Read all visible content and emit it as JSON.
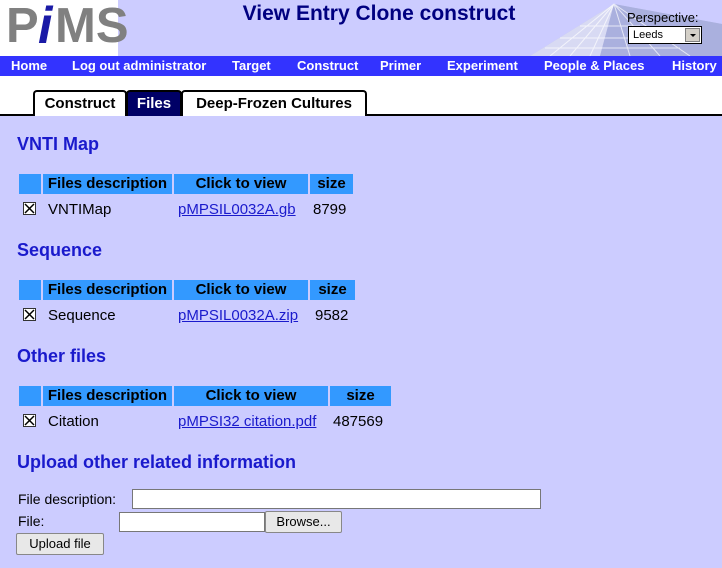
{
  "header": {
    "logo_letters": [
      "P",
      "i",
      "MS"
    ],
    "title": "View Entry Clone construct",
    "perspective_label": "Perspective:",
    "perspective_value": "Leeds"
  },
  "nav": [
    "Home",
    "Log out administrator",
    "Target",
    "Construct",
    "Primer",
    "Experiment",
    "People & Places",
    "History"
  ],
  "tabs": [
    {
      "label": "Construct",
      "active": false
    },
    {
      "label": "Files",
      "active": true
    },
    {
      "label": "Deep-Frozen Cultures",
      "active": false
    }
  ],
  "sections": [
    {
      "title": "VNTI Map",
      "headers": [
        "Files description",
        "Click to view",
        "size"
      ],
      "rows": [
        {
          "description": "VNTIMap",
          "file": "pMPSIL0032A.gb",
          "size": "8799"
        }
      ]
    },
    {
      "title": "Sequence",
      "headers": [
        "Files description",
        "Click to view",
        "size"
      ],
      "rows": [
        {
          "description": "Sequence",
          "file": "pMPSIL0032A.zip",
          "size": "9582"
        }
      ]
    },
    {
      "title": "Other files",
      "headers": [
        "Files description",
        "Click to view",
        "size"
      ],
      "rows": [
        {
          "description": "Citation",
          "file": "pMPSI32 citation.pdf",
          "size": "487569"
        }
      ]
    }
  ],
  "upload": {
    "title": "Upload other related information",
    "description_label": "File description:",
    "file_label": "File:",
    "browse_label": "Browse...",
    "upload_label": "Upload file"
  },
  "colors": {
    "background": "#ccccff",
    "navbar": "#3333ff",
    "table_header": "#3399ff",
    "section_title": "#1a1acc",
    "active_tab": "#000066"
  }
}
